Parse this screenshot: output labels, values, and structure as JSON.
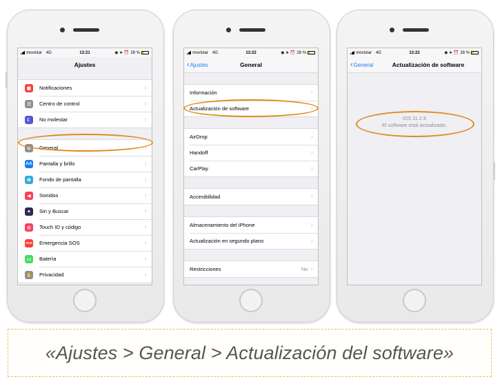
{
  "status": {
    "carrier": "movistar",
    "network": "4G",
    "battery": "28 %",
    "time1": "13:21",
    "time2": "13:22",
    "time3": "13:22"
  },
  "screen1": {
    "title": "Ajustes",
    "group1": [
      {
        "label": "Notificaciones",
        "icon": "notifications-icon",
        "color": "#fc3d39"
      },
      {
        "label": "Centro de control",
        "icon": "control-center-icon",
        "color": "#8e8e93"
      },
      {
        "label": "No molestar",
        "icon": "moon-icon",
        "color": "#5856d6"
      }
    ],
    "group2": [
      {
        "label": "General",
        "icon": "gear-icon",
        "color": "#8e8e93"
      },
      {
        "label": "Pantalla y brillo",
        "icon": "display-icon",
        "color": "#1c7cf4"
      },
      {
        "label": "Fondo de pantalla",
        "icon": "wallpaper-icon",
        "color": "#34aadc"
      },
      {
        "label": "Sonidos",
        "icon": "sound-icon",
        "color": "#fc3d58"
      },
      {
        "label": "Siri y Buscar",
        "icon": "siri-icon",
        "color": "#2b2b4f"
      },
      {
        "label": "Touch ID y código",
        "icon": "fingerprint-icon",
        "color": "#fc3d58"
      },
      {
        "label": "Emergencia SOS",
        "icon": "sos-icon",
        "color": "#fc3d39"
      },
      {
        "label": "Batería",
        "icon": "battery-icon",
        "color": "#4cd964"
      },
      {
        "label": "Privacidad",
        "icon": "hand-icon",
        "color": "#8e8e93"
      }
    ]
  },
  "screen2": {
    "back": "Ajustes",
    "title": "General",
    "group1": [
      {
        "label": "Información"
      },
      {
        "label": "Actualización de software"
      }
    ],
    "group2": [
      {
        "label": "AirDrop"
      },
      {
        "label": "Handoff"
      },
      {
        "label": "CarPlay"
      }
    ],
    "group3": [
      {
        "label": "Accesibilidad"
      }
    ],
    "group4": [
      {
        "label": "Almacenamiento del iPhone"
      },
      {
        "label": "Actualización en segundo plano"
      }
    ],
    "group5": [
      {
        "label": "Restricciones",
        "detail": "No"
      }
    ]
  },
  "screen3": {
    "back": "General",
    "title": "Actualización de software",
    "version": "iOS 11.2.6",
    "message": "El software está actualizado."
  },
  "caption": "«Ajustes > General > Actualización del software»",
  "colors": {
    "accent": "#1c7cf4",
    "highlight": "#e08b1b"
  }
}
